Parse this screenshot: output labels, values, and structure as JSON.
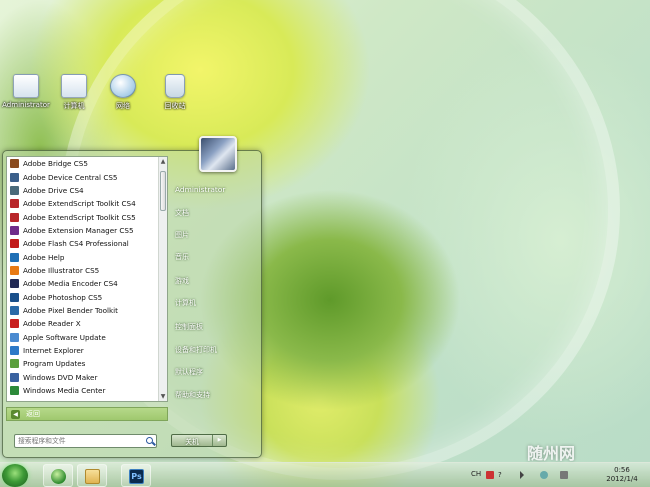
{
  "desktop": {
    "icons": [
      {
        "label": "Administrator",
        "icon": "user-folder-icon"
      },
      {
        "label": "计算机",
        "icon": "computer-icon"
      },
      {
        "label": "网络",
        "icon": "network-icon"
      },
      {
        "label": "回收站",
        "icon": "recycle-bin-icon"
      }
    ]
  },
  "start_menu": {
    "programs": [
      {
        "label": "Adobe Bridge CS5",
        "color": "#8a4b1f"
      },
      {
        "label": "Adobe Device Central CS5",
        "color": "#3b5f8a"
      },
      {
        "label": "Adobe Drive CS4",
        "color": "#4a6a7a"
      },
      {
        "label": "Adobe ExtendScript Toolkit CS4",
        "color": "#b8262a"
      },
      {
        "label": "Adobe ExtendScript Toolkit CS5",
        "color": "#b8262a"
      },
      {
        "label": "Adobe Extension Manager CS5",
        "color": "#6f2c8a"
      },
      {
        "label": "Adobe Flash CS4 Professional",
        "color": "#c21a1a"
      },
      {
        "label": "Adobe Help",
        "color": "#1f6fb5"
      },
      {
        "label": "Adobe Illustrator CS5",
        "color": "#e87a14"
      },
      {
        "label": "Adobe Media Encoder CS4",
        "color": "#222a55"
      },
      {
        "label": "Adobe Photoshop CS5",
        "color": "#1a4f8a"
      },
      {
        "label": "Adobe Pixel Bender Toolkit",
        "color": "#2a6aa8"
      },
      {
        "label": "Adobe Reader X",
        "color": "#c81e1e"
      },
      {
        "label": "Apple Software Update",
        "color": "#4a8ad0"
      },
      {
        "label": "Internet Explorer",
        "color": "#2d79c7"
      },
      {
        "label": "Program Updates",
        "color": "#5a9e3c"
      },
      {
        "label": "Windows DVD Maker",
        "color": "#3a62a0"
      },
      {
        "label": "Windows Media Center",
        "color": "#2c8a3a"
      }
    ],
    "back_label": "返回",
    "search_placeholder": "搜索程序和文件",
    "right_items": [
      {
        "label": "Administrator"
      },
      {
        "label": "文档"
      },
      {
        "label": "图片"
      },
      {
        "label": "音乐"
      },
      {
        "label": "游戏"
      },
      {
        "label": "计算机"
      },
      {
        "label": "控制面板"
      },
      {
        "label": "设备和打印机"
      },
      {
        "label": "默认程序"
      },
      {
        "label": "帮助和支持"
      }
    ],
    "shutdown_label": "关机"
  },
  "taskbar": {
    "tray_language": "CH",
    "clock_time": "0:56",
    "clock_date": "2012/1/4",
    "pinned": [
      {
        "name": "ie-icon",
        "color": "#2d8a2d"
      },
      {
        "name": "explorer-folder-icon",
        "color": "#e8c26a"
      },
      {
        "name": "photoshop-icon",
        "label": "Ps"
      }
    ]
  },
  "watermark": "随州网"
}
